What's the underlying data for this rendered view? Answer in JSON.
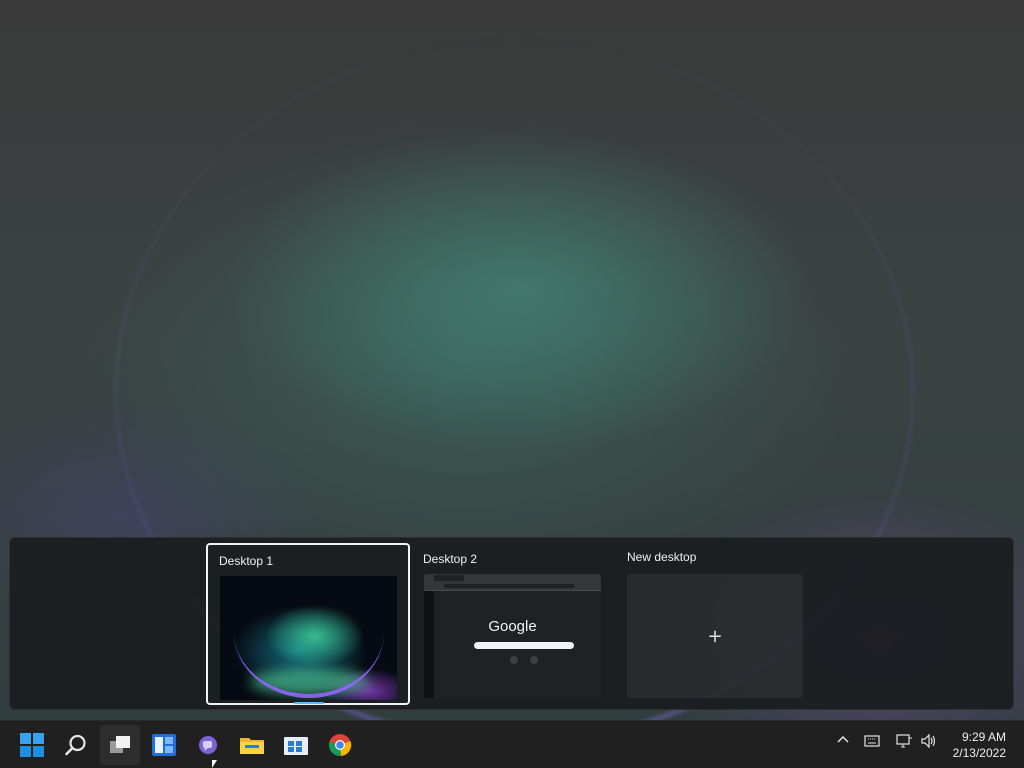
{
  "task_view": {
    "desktops": [
      {
        "label": "Desktop 1",
        "selected": true
      },
      {
        "label": "Desktop 2",
        "selected": false
      }
    ],
    "new_desktop_label": "New desktop",
    "new_desktop_glyph": "+",
    "desktop2_thumbnail": {
      "logo_text": "Google"
    }
  },
  "taskbar": {
    "apps": [
      {
        "name": "start",
        "icon": "windows-logo-icon"
      },
      {
        "name": "search",
        "icon": "search-icon"
      },
      {
        "name": "task-view",
        "icon": "task-view-icon",
        "active": true
      },
      {
        "name": "widgets",
        "icon": "widgets-icon"
      },
      {
        "name": "chat",
        "icon": "chat-icon"
      },
      {
        "name": "file-explorer",
        "icon": "folder-icon"
      },
      {
        "name": "microsoft-store",
        "icon": "store-icon"
      },
      {
        "name": "chrome",
        "icon": "chrome-icon"
      }
    ],
    "tray": {
      "icons": [
        "chevron-up-icon",
        "keyboard-icon",
        "network-icon",
        "volume-icon"
      ],
      "time": "9:29 AM",
      "date": "2/13/2022"
    }
  },
  "colors": {
    "taskbar_bg": "#202020",
    "accent": "#4cc2ff",
    "panel_bg": "#1a1c1e"
  }
}
